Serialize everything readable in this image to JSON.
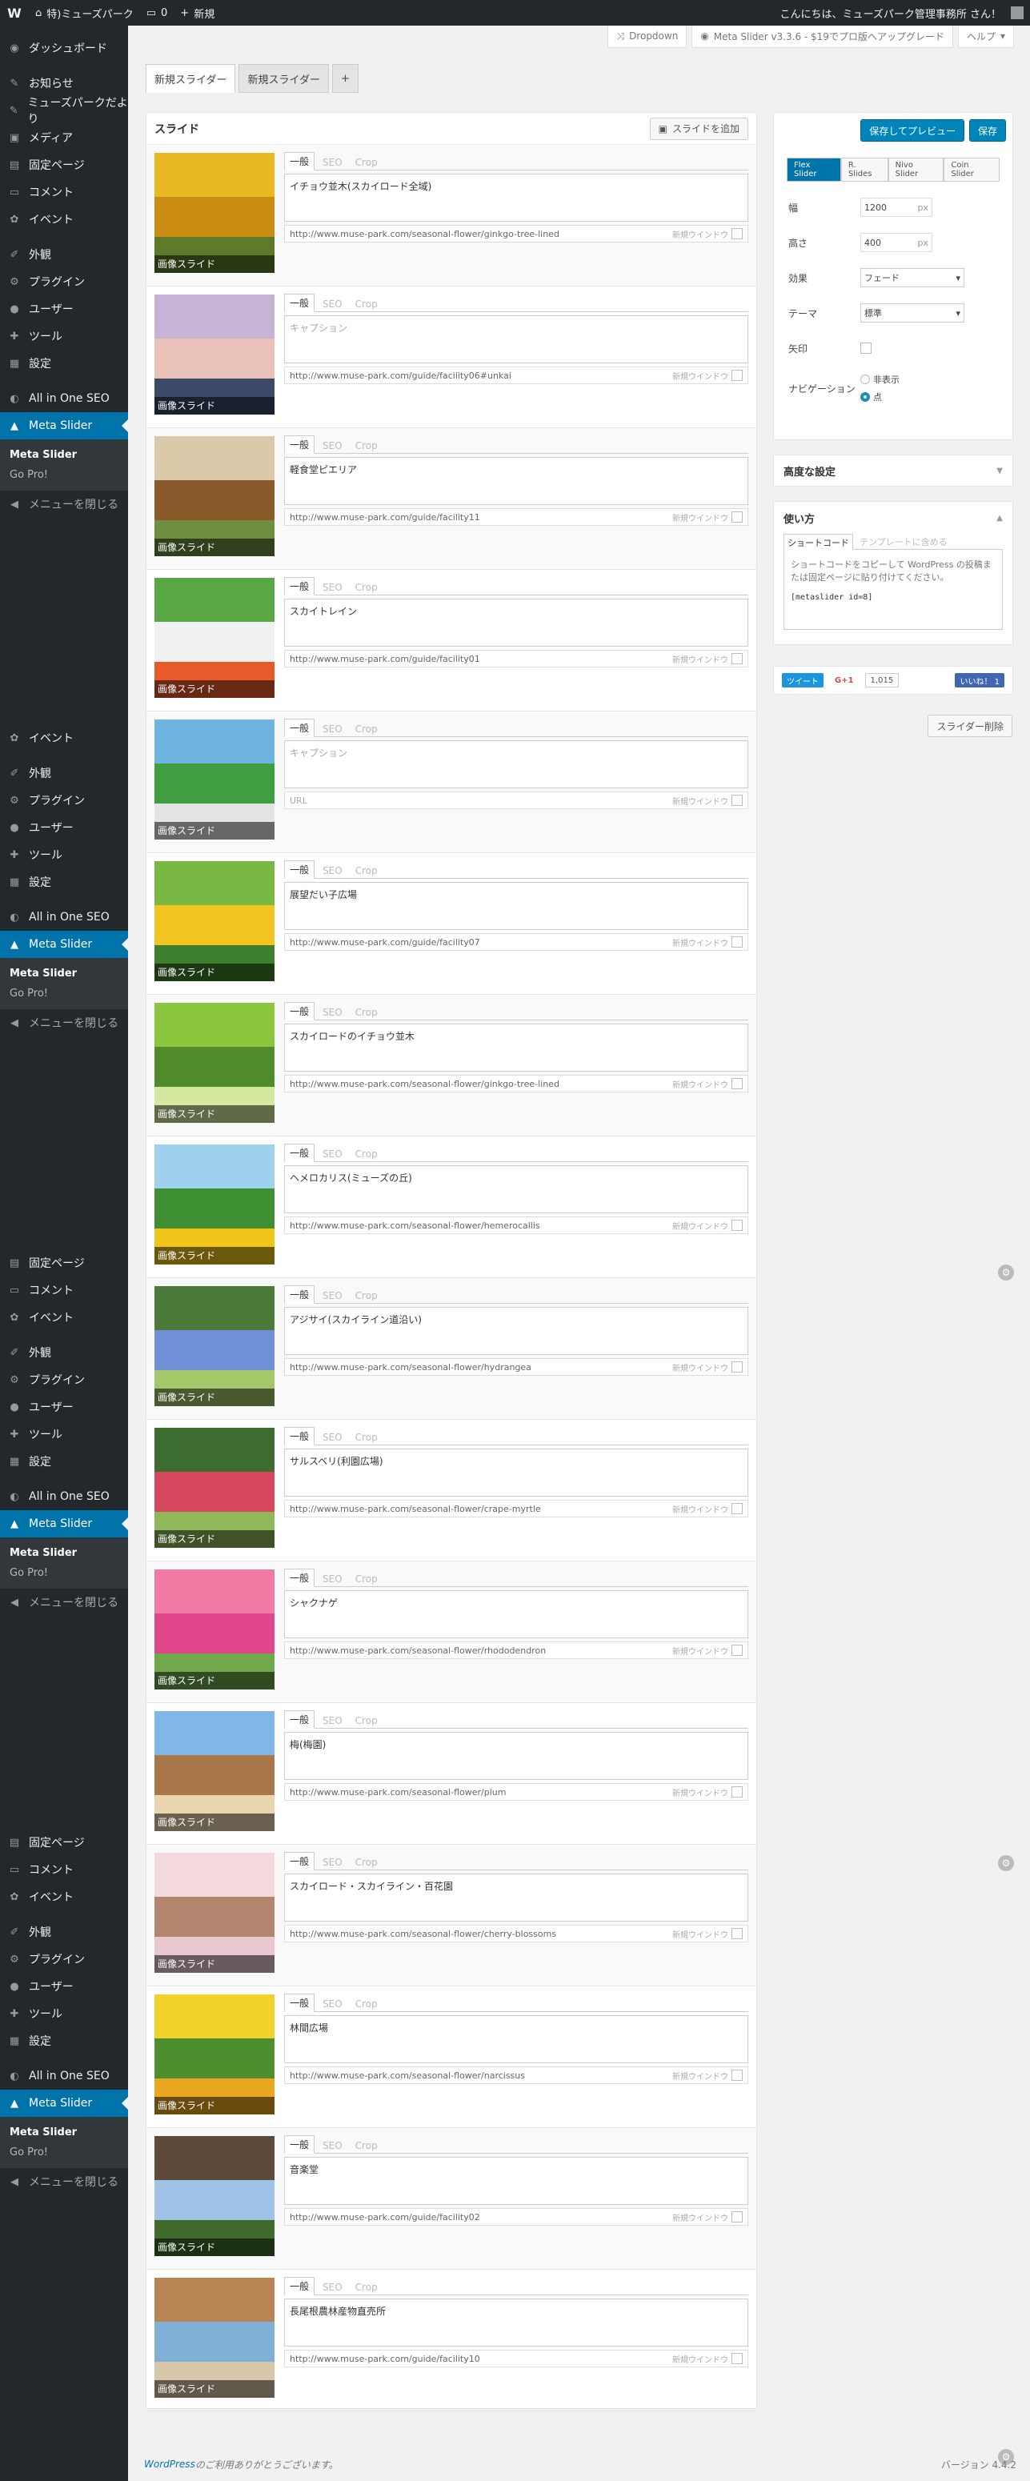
{
  "adminbar": {
    "site": "特)ミューズパーク",
    "comments": "0",
    "new": "新規",
    "greeting": "こんにちは、ミューズパーク管理事務所 さん！"
  },
  "menu": {
    "dashboard": "ダッシュボード",
    "posts": "お知らせ",
    "museparkdayori": "ミューズパークだより",
    "media": "メディア",
    "pages": "固定ページ",
    "comments": "コメント",
    "events": "イベント",
    "appearance": "外観",
    "plugins": "プラグイン",
    "users": "ユーザー",
    "tools": "ツール",
    "settings": "設定",
    "seo": "All in One SEO",
    "metaslider": "Meta Slider",
    "sub_metaslider": "Meta Slider",
    "gopro": "Go Pro!",
    "collapse": "メニューを閉じる"
  },
  "toptabs": {
    "dropdown": "Dropdown",
    "upgrade": "Meta Slider v3.3.6 - $19でプロ版へアップグレード",
    "help": "ヘルプ"
  },
  "slidertabs": [
    "新規スライダー",
    "新規スライダー",
    "+"
  ],
  "slides_panel": {
    "title": "スライド",
    "add_button": "スライドを追加",
    "tab_general": "一般",
    "tab_seo": "SEO",
    "tab_crop": "Crop",
    "thumb_label": "画像スライド",
    "new_window": "新規ウインドウ"
  },
  "slides": [
    {
      "caption": "イチョウ並木(スカイロード全域)",
      "url": "http://www.muse-park.com/seasonal-flower/ginkgo-tree-lined"
    },
    {
      "caption": "キャプション",
      "url": "http://www.muse-park.com/guide/facility06#unkai"
    },
    {
      "caption": "軽食堂ピエリア",
      "url": "http://www.muse-park.com/guide/facility11"
    },
    {
      "caption": "スカイトレイン",
      "url": "http://www.muse-park.com/guide/facility01"
    },
    {
      "caption": "キャプション",
      "url": "URL"
    },
    {
      "caption": "展望だい子広場",
      "url": "http://www.muse-park.com/guide/facility07"
    },
    {
      "caption": "スカイロードのイチョウ並木",
      "url": "http://www.muse-park.com/seasonal-flower/ginkgo-tree-lined"
    },
    {
      "caption": "ヘメロカリス(ミューズの丘)",
      "url": "http://www.muse-park.com/seasonal-flower/hemerocallis"
    },
    {
      "caption": "アジサイ(スカイライン道沿い)",
      "url": "http://www.muse-park.com/seasonal-flower/hydrangea"
    },
    {
      "caption": "サルスベリ(利園広場)",
      "url": "http://www.muse-park.com/seasonal-flower/crape-myrtle"
    },
    {
      "caption": "シャクナゲ",
      "url": "http://www.muse-park.com/seasonal-flower/rhododendron"
    },
    {
      "caption": "梅(梅園)",
      "url": "http://www.muse-park.com/seasonal-flower/plum"
    },
    {
      "caption": "スカイロード・スカイライン・百花園",
      "url": "http://www.muse-park.com/seasonal-flower/cherry-blossoms"
    },
    {
      "caption": "林間広場",
      "url": "http://www.muse-park.com/seasonal-flower/narcissus"
    },
    {
      "caption": "音楽堂",
      "url": "http://www.muse-park.com/guide/facility02"
    },
    {
      "caption": "長尾根農林産物直売所",
      "url": "http://www.muse-park.com/guide/facility10"
    }
  ],
  "settings": {
    "save_preview": "保存してプレビュー",
    "save": "保存",
    "types": [
      "Flex Slider",
      "R. Slides",
      "Nivo Slider",
      "Coin Slider"
    ],
    "width_label": "幅",
    "width": "1200",
    "height_label": "高さ",
    "height": "400",
    "px": "px",
    "effect_label": "効果",
    "effect": "フェード",
    "theme_label": "テーマ",
    "theme": "標準",
    "arrows_label": "矢印",
    "nav_label": "ナビゲーション",
    "nav_hidden": "非表示",
    "nav_dots": "点"
  },
  "advanced": "高度な設定",
  "usage": {
    "title": "使い方",
    "tab_shortcode": "ショートコード",
    "tab_template": "テンプレートに含める",
    "desc": "ショートコードをコピーして WordPress の投稿または固定ページに貼り付けてください。",
    "code": "[metaslider id=8]"
  },
  "social": {
    "tweet": "ツイート",
    "gplus": "G+1",
    "count": "1,015",
    "like": "いいね！ 1"
  },
  "delete_button": "スライダー削除",
  "footer": {
    "wp": "WordPress",
    "thanks": " のご利用ありがとうございます。",
    "version": "バージョン 4.4.2"
  },
  "colors": {
    "accent": "#0073aa",
    "menu_bg": "#23282d"
  }
}
